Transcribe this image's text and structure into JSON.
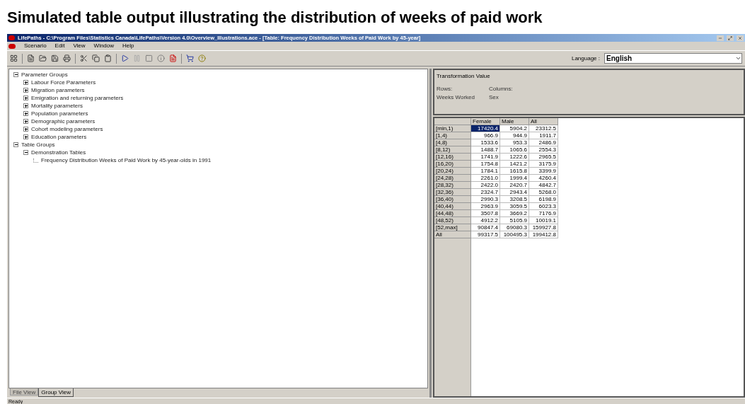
{
  "slide_title": "Simulated table output illustrating the distribution of weeks of paid work",
  "window": {
    "title": "LifePaths - C:\\Program Files\\Statistics Canada\\LifePaths\\Version 4.0\\Overview_Illustrations.ace - [Table: Frequency Distribution Weeks of Paid Work by 45-year]"
  },
  "menu": [
    "Scenario",
    "Edit",
    "View",
    "Window",
    "Help"
  ],
  "language": {
    "label": "Language :",
    "value": "English"
  },
  "tree": [
    {
      "label": "Parameter Groups",
      "expanded": true,
      "children": [
        {
          "label": "Labour Force Parameters",
          "expanded": false
        },
        {
          "label": "Migration parameters",
          "expanded": false
        },
        {
          "label": "Emigration and returning parameters",
          "expanded": false
        },
        {
          "label": "Mortality parameters",
          "expanded": false
        },
        {
          "label": "Population parameters",
          "expanded": false
        },
        {
          "label": "Demographic parameters",
          "expanded": false
        },
        {
          "label": "Cohort modeling parameters",
          "expanded": false
        },
        {
          "label": "Education parameters",
          "expanded": false
        }
      ]
    },
    {
      "label": "Table Groups",
      "expanded": true,
      "children": [
        {
          "label": "Demonstration Tables",
          "expanded": true,
          "children": [
            {
              "label": "Frequency Distribution Weeks of Paid Work by 45-year-olds in 1991"
            }
          ]
        }
      ]
    }
  ],
  "view_tabs": [
    {
      "label": "File View",
      "selected": false
    },
    {
      "label": "Group View",
      "selected": true
    }
  ],
  "info": {
    "title": "Transformation Value",
    "rows_label": "Rows:",
    "columns_label": "Columns:",
    "rows_value": "Weeks Worked",
    "columns_value": "Sex"
  },
  "table": {
    "columns": [
      "Female",
      "Male",
      "All"
    ],
    "rows": [
      {
        "label": "[min,1)",
        "cells": [
          "17420.4",
          "5904.2",
          "23312.5"
        ],
        "selected": true
      },
      {
        "label": "[1,4)",
        "cells": [
          "966.9",
          "944.9",
          "1911.7"
        ],
        "selected": false
      },
      {
        "label": "[4,8)",
        "cells": [
          "1533.6",
          "953.3",
          "2486.9"
        ],
        "selected": false
      },
      {
        "label": "[8,12)",
        "cells": [
          "1488.7",
          "1065.6",
          "2554.3"
        ],
        "selected": false
      },
      {
        "label": "[12,16)",
        "cells": [
          "1741.9",
          "1222.6",
          "2965.5"
        ],
        "selected": false
      },
      {
        "label": "[16,20)",
        "cells": [
          "1754.8",
          "1421.2",
          "3175.9"
        ],
        "selected": false
      },
      {
        "label": "[20,24)",
        "cells": [
          "1784.1",
          "1615.8",
          "3399.9"
        ],
        "selected": false
      },
      {
        "label": "[24,28)",
        "cells": [
          "2261.0",
          "1999.4",
          "4260.4"
        ],
        "selected": false
      },
      {
        "label": "[28,32)",
        "cells": [
          "2422.0",
          "2420.7",
          "4842.7"
        ],
        "selected": false
      },
      {
        "label": "[32,36)",
        "cells": [
          "2324.7",
          "2943.4",
          "5268.0"
        ],
        "selected": false
      },
      {
        "label": "[36,40)",
        "cells": [
          "2990.3",
          "3208.5",
          "6198.9"
        ],
        "selected": false
      },
      {
        "label": "[40,44)",
        "cells": [
          "2963.9",
          "3059.5",
          "6023.3"
        ],
        "selected": false
      },
      {
        "label": "[44,48)",
        "cells": [
          "3507.8",
          "3669.2",
          "7176.9"
        ],
        "selected": false
      },
      {
        "label": "[48,52)",
        "cells": [
          "4912.2",
          "5105.9",
          "10019.1"
        ],
        "selected": false
      },
      {
        "label": "[52,max]",
        "cells": [
          "90847.4",
          "69080.3",
          "159927.8"
        ],
        "selected": false
      },
      {
        "label": "All",
        "cells": [
          "99317.5",
          "100495.3",
          "199412.8"
        ],
        "selected": false
      }
    ]
  },
  "status_bar": "Ready"
}
